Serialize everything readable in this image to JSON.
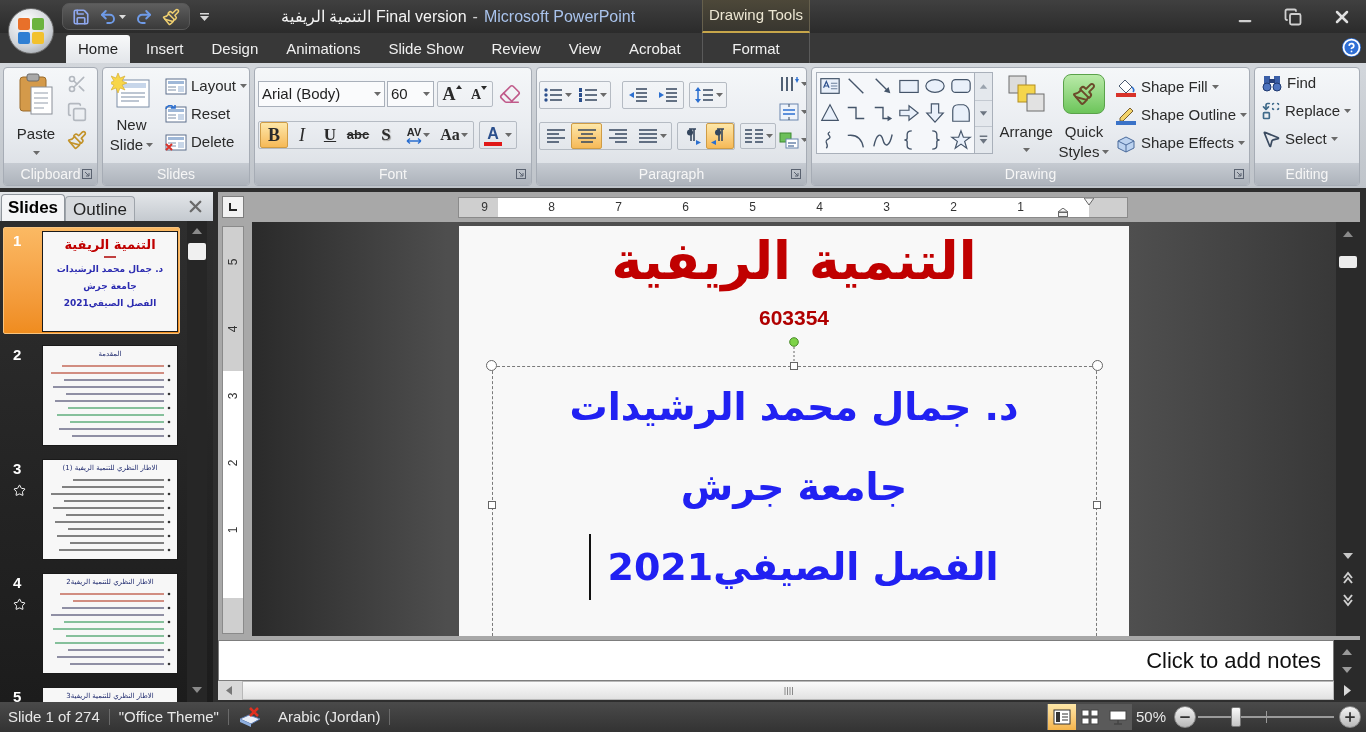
{
  "window": {
    "document": "التنمية الريفية Final version",
    "separator": "-",
    "app": "Microsoft PowerPoint",
    "contextual_group": "Drawing Tools"
  },
  "tabs": [
    {
      "label": "Home",
      "selected": true
    },
    {
      "label": "Insert",
      "selected": false
    },
    {
      "label": "Design",
      "selected": false
    },
    {
      "label": "Animations",
      "selected": false
    },
    {
      "label": "Slide Show",
      "selected": false
    },
    {
      "label": "Review",
      "selected": false
    },
    {
      "label": "View",
      "selected": false
    },
    {
      "label": "Acrobat",
      "selected": false
    }
  ],
  "contextual_tabs": [
    {
      "label": "Format",
      "selected": false
    }
  ],
  "ribbon": {
    "clipboard": {
      "label": "Clipboard",
      "paste": "Paste",
      "tools": [
        {
          "kind": "cut",
          "disabled": true
        },
        {
          "kind": "copy",
          "disabled": true
        },
        {
          "kind": "format_painter",
          "disabled": false
        }
      ]
    },
    "slides": {
      "label": "Slides",
      "new_slide": [
        "New",
        "Slide"
      ],
      "layout": "Layout",
      "reset": "Reset",
      "delete": "Delete"
    },
    "font": {
      "label": "Font",
      "font_name": "Arial (Body)",
      "font_size": "60",
      "grow": "A",
      "shrink": "A",
      "format_buttons": [
        {
          "kind": "bold",
          "glyph": "B",
          "selected": true
        },
        {
          "kind": "italic",
          "glyph": "I",
          "selected": false
        },
        {
          "kind": "underline",
          "glyph": "U",
          "selected": false
        },
        {
          "kind": "strike",
          "glyph": "abc",
          "selected": false
        },
        {
          "kind": "shadow",
          "glyph": "S",
          "selected": false
        },
        {
          "kind": "spacing",
          "glyph": "AV",
          "selected": false
        },
        {
          "kind": "case",
          "glyph": "Aa",
          "selected": false
        }
      ],
      "font_color": "A"
    },
    "paragraph": {
      "label": "Paragraph",
      "alignments": [
        {
          "kind": "left",
          "selected": false
        },
        {
          "kind": "center",
          "selected": true
        },
        {
          "kind": "right",
          "selected": false
        },
        {
          "kind": "justify",
          "selected": false
        }
      ],
      "directions": [
        {
          "kind": "ltr",
          "selected": false
        },
        {
          "kind": "rtl",
          "selected": true
        }
      ]
    },
    "drawing": {
      "label": "Drawing",
      "arrange": "Arrange",
      "quick_styles": [
        "Quick",
        "Styles"
      ],
      "shape_fill": "Shape Fill",
      "shape_outline": "Shape Outline",
      "shape_effects": "Shape Effects"
    },
    "editing": {
      "label": "Editing",
      "find": "Find",
      "replace": "Replace",
      "select": "Select"
    }
  },
  "slides_pane": {
    "tabs": [
      {
        "label": "Slides",
        "selected": true
      },
      {
        "label": "Outline",
        "selected": false
      }
    ],
    "slides": [
      {
        "number": "1",
        "selected": true,
        "animated": false,
        "kind": "title",
        "title": "التنمية الريفية",
        "lines": [
          "د. جمال محمد الرشيدات",
          "جامعة جرش",
          "الفصل الصيفي2021"
        ]
      },
      {
        "number": "2",
        "selected": false,
        "animated": false,
        "kind": "bullets",
        "title": "المقدمة"
      },
      {
        "number": "3",
        "selected": false,
        "animated": true,
        "kind": "bullets",
        "title": "الاطار النظري للتنمية الريفية (1)"
      },
      {
        "number": "4",
        "selected": false,
        "animated": true,
        "kind": "bullets",
        "title": "الاطار النظري للتنمية الريفية2"
      },
      {
        "number": "5",
        "selected": false,
        "animated": false,
        "kind": "bullets",
        "title": "الاطار النظري للتنمية الريفية3"
      }
    ]
  },
  "rulers": {
    "horizontal": [
      "9",
      "8",
      "7",
      "6",
      "5",
      "4",
      "3",
      "2",
      "1"
    ],
    "vertical": [
      "5",
      "4",
      "3",
      "2",
      "1"
    ]
  },
  "slide": {
    "title": "التنمية الريفية",
    "code": "603354",
    "lines": [
      {
        "text": "د. جمال محمد الرشيدات",
        "cursor": false
      },
      {
        "text": "جامعة جرش",
        "cursor": false
      },
      {
        "text": "الفصل الصيفي2021",
        "cursor": true
      }
    ]
  },
  "notes": {
    "placeholder": "Click to add notes"
  },
  "status_bar": {
    "slide": "Slide 1 of 274",
    "theme": "\"Office Theme\"",
    "language": "Arabic (Jordan)",
    "views": [
      {
        "kind": "normal",
        "selected": true
      },
      {
        "kind": "sorter",
        "selected": false
      },
      {
        "kind": "show",
        "selected": false
      }
    ],
    "zoom": "50%",
    "zoom_slider": {
      "level": 0.26
    }
  }
}
